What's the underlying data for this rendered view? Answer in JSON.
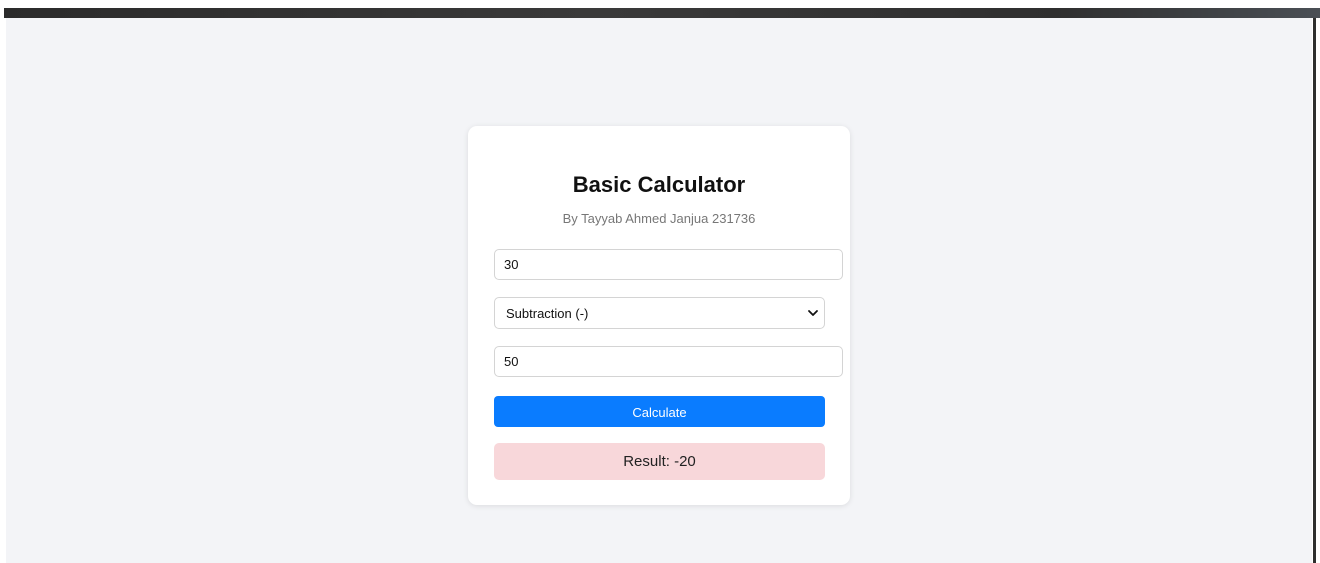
{
  "calculator": {
    "title": "Basic Calculator",
    "subtitle": "By Tayyab Ahmed Janjua 231736",
    "first_number": "30",
    "operation": {
      "selected": "Subtraction (-)",
      "icon": "chevron-down-icon"
    },
    "second_number": "50",
    "calculate_label": "Calculate",
    "result_text": "Result: -20"
  },
  "colors": {
    "page_background": "#f3f4f7",
    "button": "#0a7cff",
    "result_background": "#f8d7da"
  }
}
